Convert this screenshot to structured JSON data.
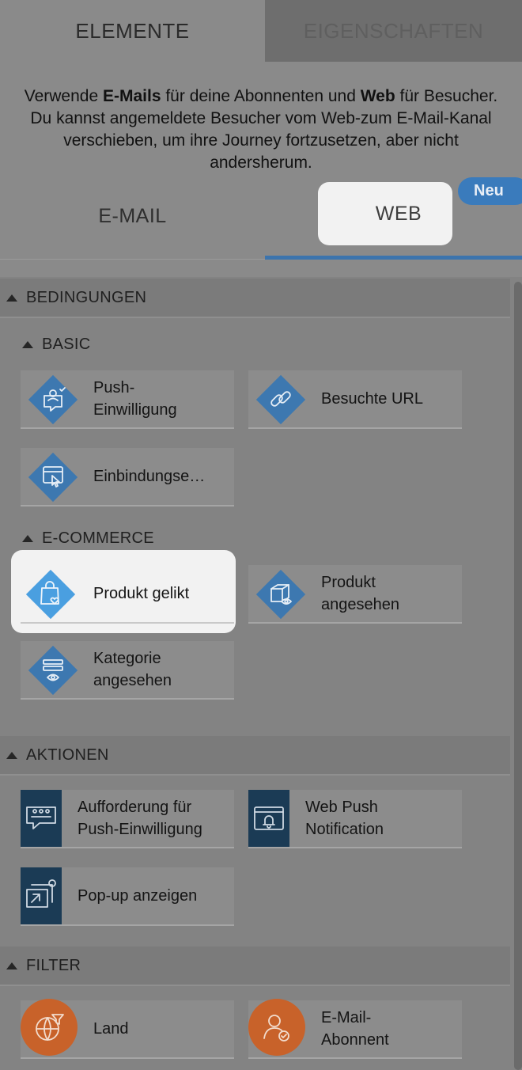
{
  "tabs": {
    "elements": "ELEMENTE",
    "properties": "EIGENSCHAFTEN"
  },
  "intro": {
    "part1": "Verwende ",
    "bold1": "E-Mails",
    "part2": " für deine Abonnenten und ",
    "bold2": "Web",
    "part3": " für Besucher. Du kannst angemeldete Besucher vom Web-zum E-Mail-Kanal verschieben, um ihre Journey fortzusetzen, aber nicht andersherum."
  },
  "channels": {
    "email": "E-MAIL",
    "web": "WEB",
    "new_badge": "Neu"
  },
  "sections": {
    "conditions": "BEDINGUNGEN",
    "basic": "BASIC",
    "ecommerce": "E-COMMERCE",
    "actions": "AKTIONEN",
    "filter": "FILTER"
  },
  "basic_items": [
    {
      "label": "Push-\nEinwilligung",
      "icon": "push-consent-icon"
    },
    {
      "label": "Besuchte URL",
      "icon": "link-icon"
    },
    {
      "label": "Einbindungse…",
      "icon": "click-page-icon"
    }
  ],
  "ecommerce_items": [
    {
      "label": "Produkt gelikt",
      "icon": "shopping-bag-heart-icon"
    },
    {
      "label": "Produkt\nangesehen",
      "icon": "box-eye-icon"
    },
    {
      "label": "Kategorie\nangesehen",
      "icon": "list-eye-icon"
    }
  ],
  "action_items": [
    {
      "label": "Aufforderung für\nPush-Einwilligung",
      "icon": "chat-bubble-icon"
    },
    {
      "label": "Web Push\nNotification",
      "icon": "browser-bell-icon"
    },
    {
      "label": "Pop-up anzeigen",
      "icon": "popup-icon"
    }
  ],
  "filter_items": [
    {
      "label": "Land",
      "icon": "globe-filter-icon"
    },
    {
      "label": "E-Mail-\nAbonnent",
      "icon": "user-check-icon"
    }
  ],
  "colors": {
    "accent_blue": "#3a7bbc",
    "diamond_blue": "#3d78b0",
    "diamond_blue_highlight": "#4a9fe0",
    "action_navy": "#1b3b55",
    "filter_orange": "#c8622a"
  }
}
